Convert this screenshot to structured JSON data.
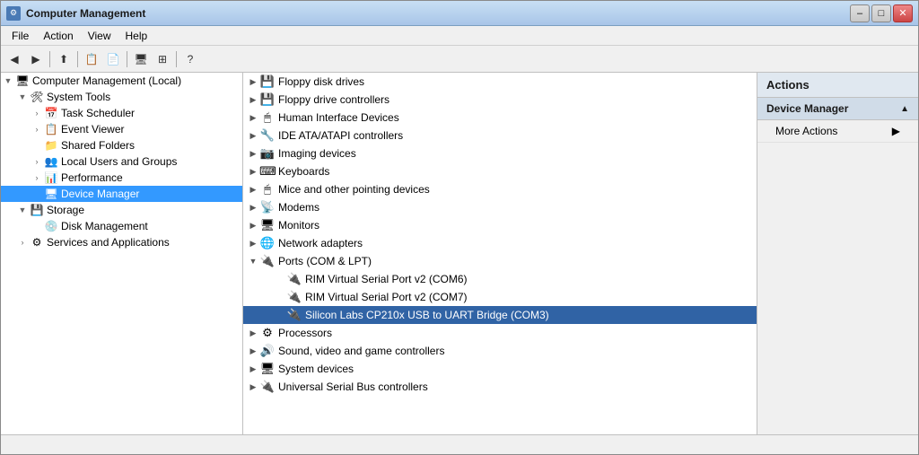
{
  "window": {
    "title": "Computer Management",
    "icon": "⚙"
  },
  "titlebar": {
    "minimize": "–",
    "maximize": "□",
    "close": "✕"
  },
  "menubar": {
    "items": [
      "File",
      "Action",
      "View",
      "Help"
    ]
  },
  "toolbar": {
    "buttons": [
      "◀",
      "▶",
      "⬆",
      "📋",
      "📄",
      "🖥",
      "⚙",
      "⚙",
      "❌",
      "⚙",
      "⚙",
      "🔧"
    ]
  },
  "left_panel": {
    "root_label": "Computer Management (Local)",
    "sections": [
      {
        "label": "System Tools",
        "expanded": true,
        "children": [
          {
            "label": "Task Scheduler",
            "icon": "📅",
            "selected": false
          },
          {
            "label": "Event Viewer",
            "icon": "📋",
            "selected": false
          },
          {
            "label": "Shared Folders",
            "icon": "📁",
            "selected": false
          },
          {
            "label": "Local Users and Groups",
            "icon": "👥",
            "selected": false
          },
          {
            "label": "Performance",
            "icon": "📊",
            "selected": false
          },
          {
            "label": "Device Manager",
            "icon": "🖥",
            "selected": true
          }
        ]
      },
      {
        "label": "Storage",
        "expanded": true,
        "children": [
          {
            "label": "Disk Management",
            "icon": "💾",
            "selected": false
          }
        ]
      },
      {
        "label": "Services and Applications",
        "expanded": false,
        "children": []
      }
    ]
  },
  "device_list": {
    "items": [
      {
        "label": "Floppy disk drives",
        "icon": "💾",
        "expanded": false,
        "indent": 0
      },
      {
        "label": "Floppy drive controllers",
        "icon": "💾",
        "expanded": false,
        "indent": 0
      },
      {
        "label": "Human Interface Devices",
        "icon": "🖱",
        "expanded": false,
        "indent": 0
      },
      {
        "label": "IDE ATA/ATAPI controllers",
        "icon": "🔧",
        "expanded": false,
        "indent": 0
      },
      {
        "label": "Imaging devices",
        "icon": "📷",
        "expanded": false,
        "indent": 0
      },
      {
        "label": "Keyboards",
        "icon": "⌨",
        "expanded": false,
        "indent": 0
      },
      {
        "label": "Mice and other pointing devices",
        "icon": "🖱",
        "expanded": false,
        "indent": 0
      },
      {
        "label": "Modems",
        "icon": "📡",
        "expanded": false,
        "indent": 0
      },
      {
        "label": "Monitors",
        "icon": "🖥",
        "expanded": false,
        "indent": 0
      },
      {
        "label": "Network adapters",
        "icon": "🌐",
        "expanded": false,
        "indent": 0
      },
      {
        "label": "Ports (COM & LPT)",
        "icon": "🔌",
        "expanded": true,
        "indent": 0
      },
      {
        "label": "RIM Virtual Serial Port v2 (COM6)",
        "icon": "🔌",
        "expanded": false,
        "indent": 1,
        "sub": true
      },
      {
        "label": "RIM Virtual Serial Port v2 (COM7)",
        "icon": "🔌",
        "expanded": false,
        "indent": 1,
        "sub": true
      },
      {
        "label": "Silicon Labs CP210x USB to UART Bridge (COM3)",
        "icon": "🔌",
        "expanded": false,
        "indent": 1,
        "sub": true,
        "selected": true
      },
      {
        "label": "Processors",
        "icon": "⚙",
        "expanded": false,
        "indent": 0
      },
      {
        "label": "Sound, video and game controllers",
        "icon": "🔊",
        "expanded": false,
        "indent": 0
      },
      {
        "label": "System devices",
        "icon": "🖥",
        "expanded": false,
        "indent": 0
      },
      {
        "label": "Universal Serial Bus controllers",
        "icon": "🔌",
        "expanded": false,
        "indent": 0
      }
    ]
  },
  "actions_panel": {
    "header": "Actions",
    "sections": [
      {
        "title": "Device Manager",
        "expanded": true,
        "items": [
          {
            "label": "More Actions",
            "arrow": "▶"
          }
        ]
      }
    ]
  },
  "status_bar": {
    "text": ""
  }
}
